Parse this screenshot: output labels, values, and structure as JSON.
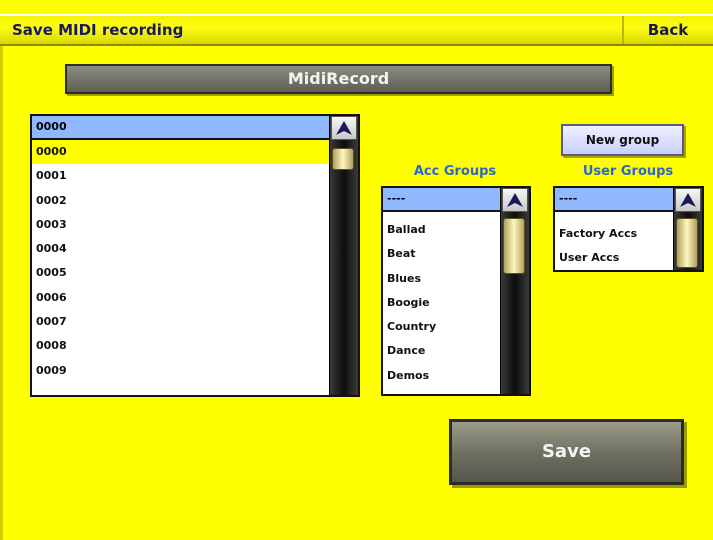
{
  "topbar": {
    "title": "Save MIDI recording",
    "back_label": "Back"
  },
  "header": {
    "title": "MidiRecord"
  },
  "file_list": {
    "selected_value": "0000",
    "items": [
      "0000",
      "0001",
      "0002",
      "0003",
      "0004",
      "0005",
      "0006",
      "0007",
      "0008",
      "0009"
    ],
    "selected_index": 0
  },
  "acc_groups": {
    "label": "Acc Groups",
    "selected_value": "----",
    "items": [
      "Ballad",
      "Beat",
      "Blues",
      "Boogie",
      "Country",
      "Dance",
      "Demos"
    ]
  },
  "user_groups": {
    "label": "User Groups",
    "selected_value": "----",
    "items": [
      "Factory Accs",
      "User Accs"
    ]
  },
  "new_group_label": "New group",
  "save_label": "Save",
  "colors": {
    "background": "#ffff00",
    "selection_field": "#8fb8ff",
    "group_label": "#2e66cc"
  }
}
